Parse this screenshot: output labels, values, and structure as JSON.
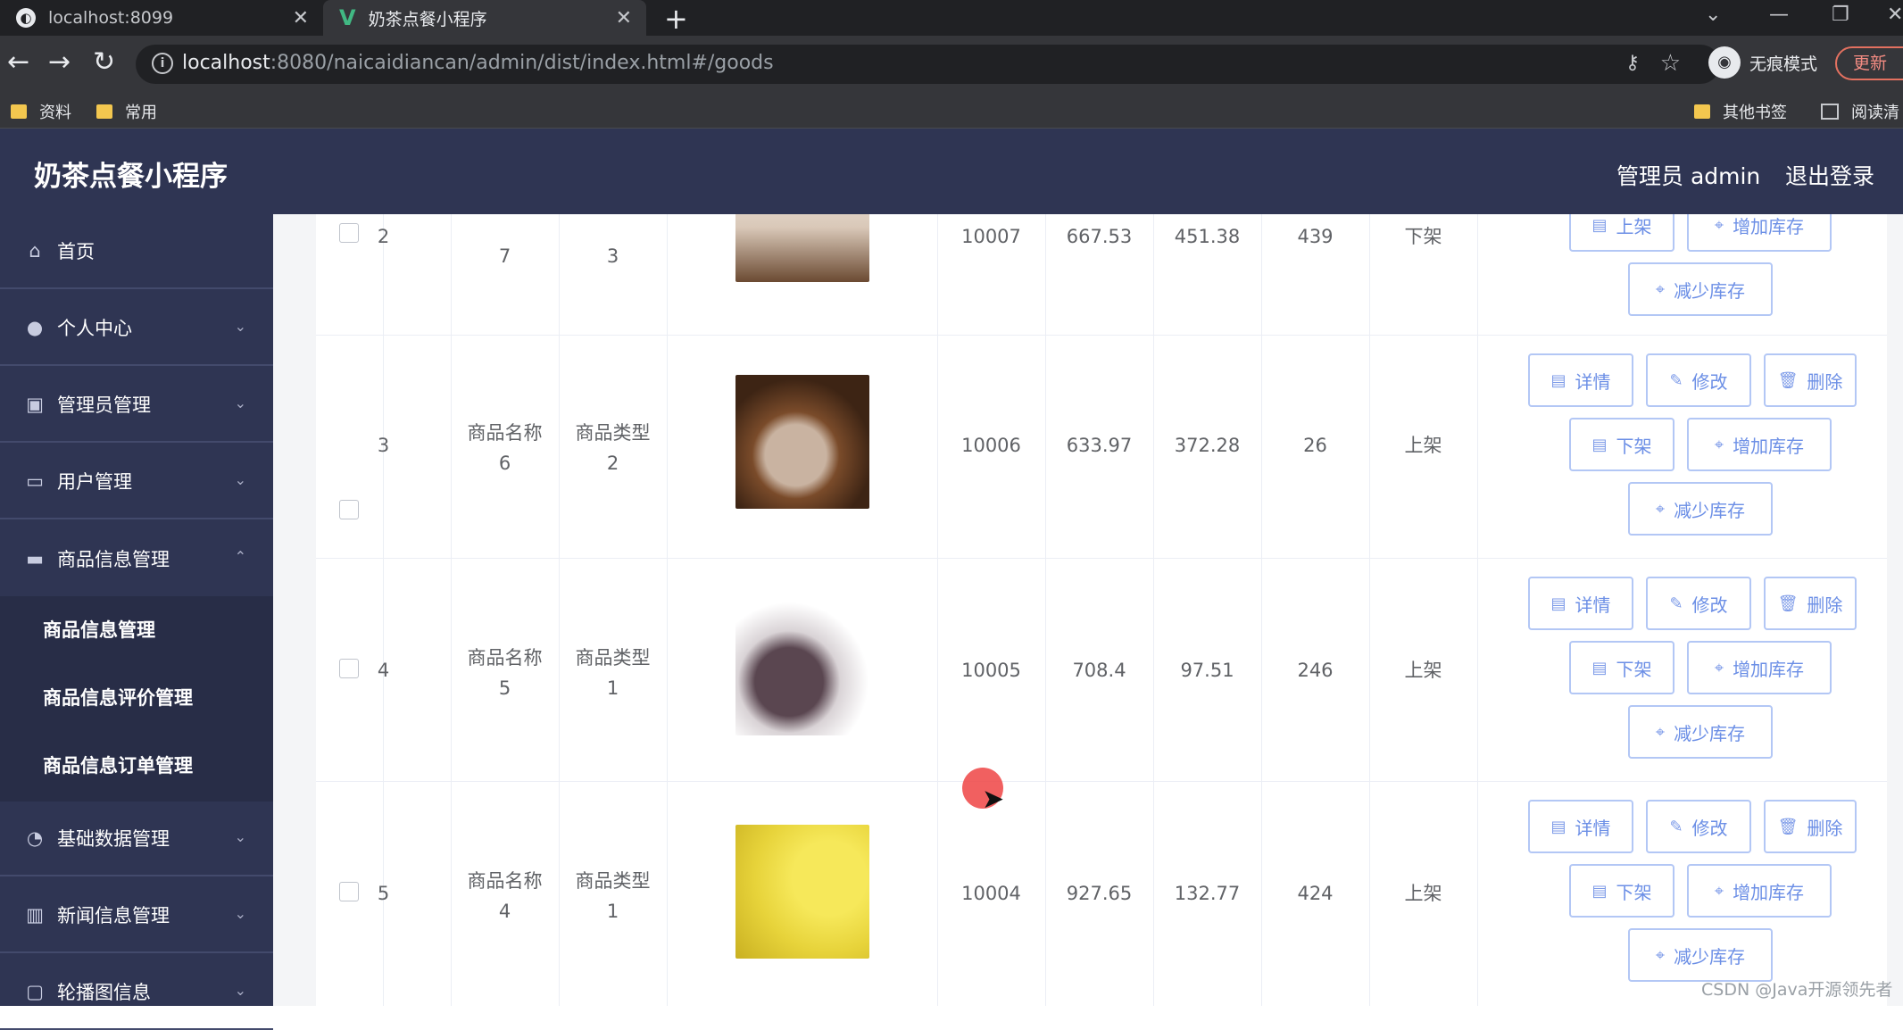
{
  "browser": {
    "tabs": [
      {
        "title": "localhost:8099",
        "icon": "globe-icon"
      },
      {
        "title": "奶茶点餐小程序",
        "icon": "vue-icon"
      }
    ],
    "url_host": "localhost",
    "url_rest": ":8080/naicaidiancan/admin/dist/index.html#/goods",
    "incognito_label": "无痕模式",
    "update_label": "更新",
    "bookmarks_left": [
      "资料",
      "常用"
    ],
    "bookmarks_right": [
      "其他书签",
      "阅读清"
    ]
  },
  "header": {
    "app_title": "奶茶点餐小程序",
    "admin_label": "管理员 admin",
    "logout_label": "退出登录"
  },
  "sidebar": {
    "items": [
      {
        "label": "首页",
        "icon": "home-icon"
      },
      {
        "label": "个人中心",
        "icon": "user-icon"
      },
      {
        "label": "管理员管理",
        "icon": "admin-icon"
      },
      {
        "label": "用户管理",
        "icon": "users-icon"
      },
      {
        "label": "商品信息管理",
        "icon": "goods-icon"
      },
      {
        "label": "基础数据管理",
        "icon": "data-icon"
      },
      {
        "label": "新闻信息管理",
        "icon": "news-icon"
      },
      {
        "label": "轮播图信息",
        "icon": "carousel-icon"
      }
    ],
    "submenu": [
      "商品信息管理",
      "商品信息评价管理",
      "商品信息订单管理"
    ]
  },
  "table": {
    "rows": [
      {
        "index": "2",
        "name_line2": "7",
        "type_line2": "3",
        "code": "10007",
        "price": "667.53",
        "member_price": "451.38",
        "stock": "439",
        "status": "下架",
        "toggle_label": "上架"
      },
      {
        "index": "3",
        "name_line1": "商品名称",
        "name_line2": "6",
        "type_line1": "商品类型",
        "type_line2": "2",
        "code": "10006",
        "price": "633.97",
        "member_price": "372.28",
        "stock": "26",
        "status": "上架",
        "toggle_label": "下架"
      },
      {
        "index": "4",
        "name_line1": "商品名称",
        "name_line2": "5",
        "type_line1": "商品类型",
        "type_line2": "1",
        "code": "10005",
        "price": "708.4",
        "member_price": "97.51",
        "stock": "246",
        "status": "上架",
        "toggle_label": "下架"
      },
      {
        "index": "5",
        "name_line1": "商品名称",
        "name_line2": "4",
        "type_line1": "商品类型",
        "type_line2": "1",
        "code": "10004",
        "price": "927.65",
        "member_price": "132.77",
        "stock": "424",
        "status": "上架",
        "toggle_label": "下架"
      }
    ],
    "actions": {
      "detail": "详情",
      "edit": "修改",
      "delete": "删除",
      "add_stock": "增加库存",
      "reduce_stock": "减少库存"
    }
  },
  "watermark": "CSDN @Java开源领先者",
  "colors": {
    "header_bg": "#2f3553",
    "button_text": "#6c8fe6",
    "button_border": "#b3c7f5"
  }
}
